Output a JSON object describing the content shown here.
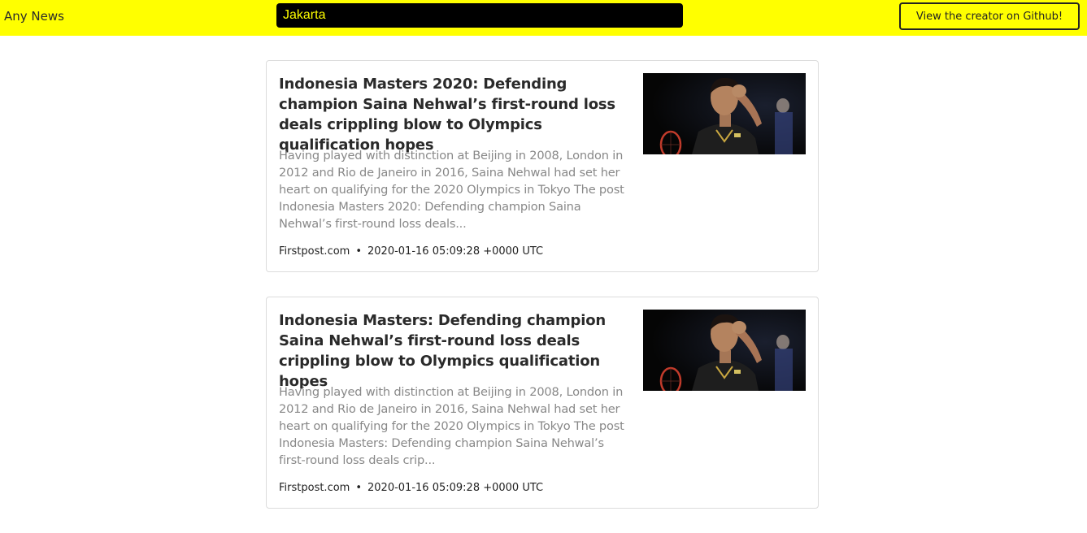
{
  "navbar": {
    "brand": "Any News",
    "search_value": "Jakarta",
    "github_button": "View the creator on Github!",
    "accent_color": "#ffff00"
  },
  "articles": [
    {
      "title": "Indonesia Masters 2020: Defending champion Saina Nehwal’s first-round loss deals crippling blow to Olympics qualification hopes",
      "description": "Having played with distinction at Beijing in 2008, London in 2012 and Rio de Janeiro in 2016, Saina Nehwal had set her heart on qualifying for the 2020 Olympics in Tokyo The post Indonesia Masters 2020: Defending champion Saina Nehwal’s first-round loss deals...",
      "source": "Firstpost.com",
      "separator": "•",
      "published": "2020-01-16 05:09:28 +0000 UTC",
      "image_icon": "badminton-player-photo"
    },
    {
      "title": "Indonesia Masters: Defending champion Saina Nehwal’s first-round loss deals crippling blow to Olympics qualification hopes",
      "description": "Having played with distinction at Beijing in 2008, London in 2012 and Rio de Janeiro in 2016, Saina Nehwal had set her heart on qualifying for the 2020 Olympics in Tokyo The post Indonesia Masters: Defending champion Saina Nehwal’s first-round loss deals crip...",
      "source": "Firstpost.com",
      "separator": "•",
      "published": "2020-01-16 05:09:28 +0000 UTC",
      "image_icon": "badminton-player-photo"
    }
  ]
}
